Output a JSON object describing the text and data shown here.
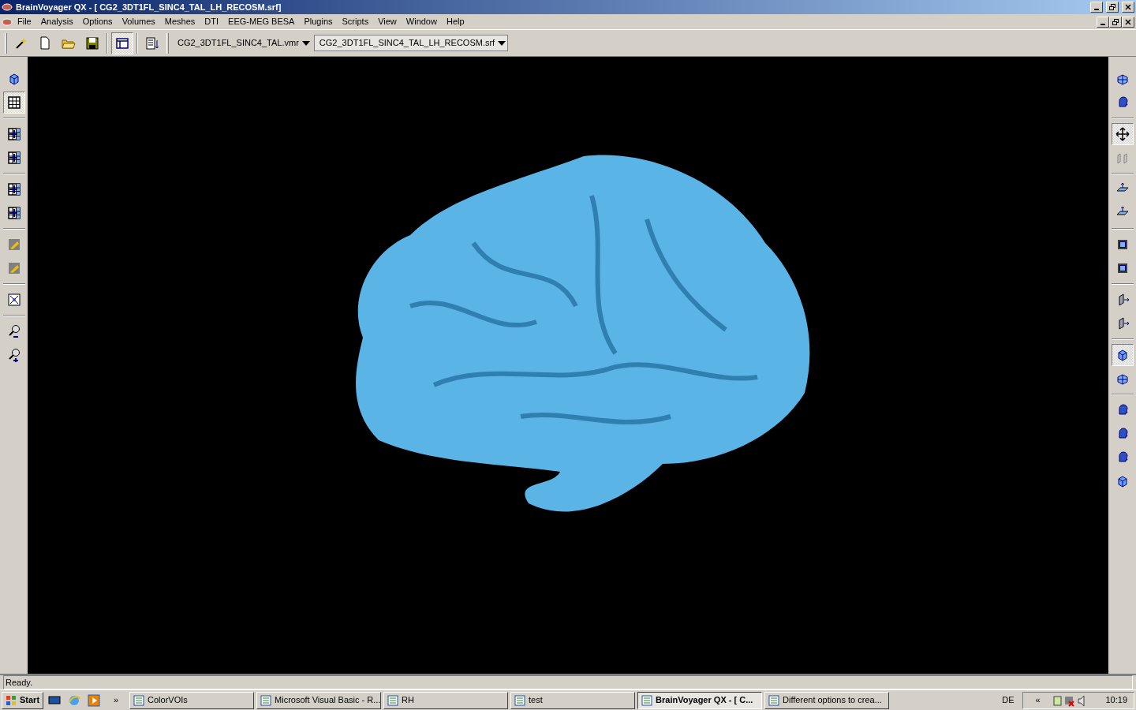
{
  "window": {
    "title": "BrainVoyager QX - [ CG2_3DT1FL_SINC4_TAL_LH_RECOSM.srf]"
  },
  "menu": [
    "File",
    "Analysis",
    "Options",
    "Volumes",
    "Meshes",
    "DTI",
    "EEG-MEG BESA",
    "Plugins",
    "Scripts",
    "View",
    "Window",
    "Help"
  ],
  "toolbar": {
    "buttons": [
      {
        "kind": "wand",
        "selected": false
      },
      {
        "kind": "new",
        "selected": false
      },
      {
        "kind": "open",
        "selected": false
      },
      {
        "kind": "save",
        "selected": false
      },
      {
        "kind": "layout",
        "selected": true
      },
      {
        "kind": "list",
        "selected": false
      }
    ],
    "vmr_select": {
      "value": "CG2_3DT1FL_SINC4_TAL.vmr"
    },
    "srf_select": {
      "value": "CG2_3DT1FL_SINC4_TAL_LH_RECOSM.srf"
    }
  },
  "left_toolbar": {
    "groups": [
      {
        "buttons": [
          {
            "kind": "cube",
            "selected": false
          },
          {
            "kind": "grid",
            "selected": true
          }
        ]
      },
      {
        "buttons": [
          {
            "kind": "grid-arrow",
            "selected": false
          },
          {
            "kind": "grid-arrow",
            "selected": false
          }
        ]
      },
      {
        "buttons": [
          {
            "kind": "grid-arrow",
            "selected": false
          },
          {
            "kind": "grid-arrow",
            "selected": false
          }
        ]
      },
      {
        "buttons": [
          {
            "kind": "tile",
            "selected": false
          },
          {
            "kind": "tile",
            "selected": false
          }
        ]
      },
      {
        "buttons": [
          {
            "kind": "fit",
            "selected": false
          }
        ]
      },
      {
        "buttons": [
          {
            "kind": "zoom-out",
            "selected": false
          },
          {
            "kind": "zoom-in",
            "selected": false
          }
        ]
      }
    ]
  },
  "right_toolbar": {
    "groups": [
      {
        "buttons": [
          {
            "kind": "cube-grid",
            "selected": false
          },
          {
            "kind": "head",
            "selected": false
          }
        ]
      },
      {
        "buttons": [
          {
            "kind": "move",
            "selected": true
          },
          {
            "kind": "slices",
            "selected": false
          }
        ]
      },
      {
        "buttons": [
          {
            "kind": "plane",
            "selected": false
          },
          {
            "kind": "plane",
            "selected": false
          }
        ]
      },
      {
        "buttons": [
          {
            "kind": "frame",
            "selected": false
          },
          {
            "kind": "frame",
            "selected": false
          }
        ]
      },
      {
        "buttons": [
          {
            "kind": "slab",
            "selected": false
          },
          {
            "kind": "slab",
            "selected": false
          }
        ]
      },
      {
        "buttons": [
          {
            "kind": "cube",
            "selected": true
          },
          {
            "kind": "cube-grid",
            "selected": false
          }
        ]
      },
      {
        "buttons": [
          {
            "kind": "head",
            "selected": false
          },
          {
            "kind": "head",
            "selected": false
          },
          {
            "kind": "head",
            "selected": false
          },
          {
            "kind": "cube",
            "selected": false
          }
        ]
      }
    ]
  },
  "status_bar": {
    "text": "Ready."
  },
  "taskbar": {
    "start": "Start",
    "chevron": "»",
    "tasks": [
      {
        "label": "ColorVOIs",
        "selected": false
      },
      {
        "label": "Microsoft Visual Basic - R...",
        "selected": false
      },
      {
        "label": "RH",
        "selected": false
      },
      {
        "label": "test",
        "selected": false
      },
      {
        "label": "BrainVoyager QX - [ C...",
        "selected": true
      },
      {
        "label": "Different options to crea...",
        "selected": false
      }
    ],
    "language": "DE",
    "tray_chevron": "«",
    "clock": "10:19"
  }
}
